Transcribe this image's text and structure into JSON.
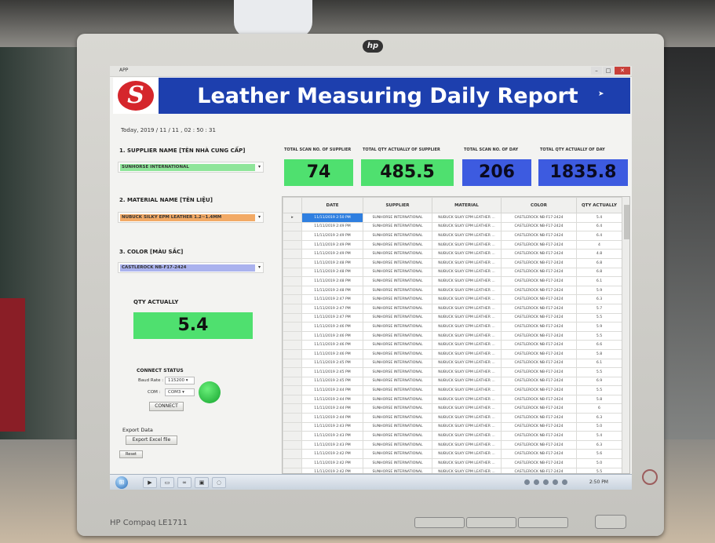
{
  "window": {
    "title": "APP",
    "controls": {
      "minimize": "–",
      "maximize": "□",
      "close": "✕"
    }
  },
  "banner": {
    "logo_letter": "S",
    "title": "Leather Measuring Daily Report"
  },
  "today": "Today, 2019 / 11 / 11 , 02 : 50 : 31",
  "supplier": {
    "label": "1. SUPPLIER NAME [TÊN NHÀ CUNG CẤP]",
    "value": "SUNHORSE INTERNATIONAL",
    "color": "#4fe06f"
  },
  "material": {
    "label": "2. MATERIAL NAME [TÊN LIỆU]",
    "value": "NUBUCK SILKY EPM LEATHER 1.2~1.4MM",
    "color": "#f0a05a"
  },
  "color_field": {
    "label": "3. COLOR [MÀU SẮC]",
    "value": "CASTLEROCK NB-F17-2424",
    "color": "#a5aef0"
  },
  "qty_actually": {
    "label": "QTY ACTUALLY",
    "value": "5.4"
  },
  "connect": {
    "title": "CONNECT STATUS",
    "baud_label": "Baud Rate :",
    "baud_value": "115200",
    "com_label": "COM :",
    "com_value": "COM3",
    "status_color": "#13a32d",
    "button": "CONNECT"
  },
  "export": {
    "label": "Export Data",
    "button": "Export Excel file",
    "reset": "Reset"
  },
  "kpis": [
    {
      "label": "TOTAL SCAN NO. OF SUPPLIER",
      "value": "74",
      "color": "green"
    },
    {
      "label": "TOTAL QTY ACTUALLY OF SUPPLIER",
      "value": "485.5",
      "color": "green"
    },
    {
      "label": "TOTAL SCAN NO. OF DAY",
      "value": "206",
      "color": "blue"
    },
    {
      "label": "TOTAL QTY ACTUALLY OF DAY",
      "value": "1835.8",
      "color": "blue"
    }
  ],
  "table": {
    "columns": [
      "DATE",
      "SUPPLIER",
      "MATERIAL",
      "COLOR",
      "QTY ACTUALLY"
    ],
    "rows": [
      [
        "11/11/2019 2:50 PM",
        "SUNHORSE INTERNATIONAL",
        "NUBUCK SILKY EPM LEATHER ...",
        "CASTLEROCK NB-F17-2424",
        "5.4"
      ],
      [
        "11/11/2019 2:49 PM",
        "SUNHORSE INTERNATIONAL",
        "NUBUCK SILKY EPM LEATHER ...",
        "CASTLEROCK NB-F17-2424",
        "6.4"
      ],
      [
        "11/11/2019 2:49 PM",
        "SUNHORSE INTERNATIONAL",
        "NUBUCK SILKY EPM LEATHER ...",
        "CASTLEROCK NB-F17-2424",
        "6.4"
      ],
      [
        "11/11/2019 2:49 PM",
        "SUNHORSE INTERNATIONAL",
        "NUBUCK SILKY EPM LEATHER ...",
        "CASTLEROCK NB-F17-2424",
        "4"
      ],
      [
        "11/11/2019 2:49 PM",
        "SUNHORSE INTERNATIONAL",
        "NUBUCK SILKY EPM LEATHER ...",
        "CASTLEROCK NB-F17-2424",
        "4.8"
      ],
      [
        "11/11/2019 2:48 PM",
        "SUNHORSE INTERNATIONAL",
        "NUBUCK SILKY EPM LEATHER ...",
        "CASTLEROCK NB-F17-2424",
        "6.8"
      ],
      [
        "11/11/2019 2:48 PM",
        "SUNHORSE INTERNATIONAL",
        "NUBUCK SILKY EPM LEATHER ...",
        "CASTLEROCK NB-F17-2424",
        "6.8"
      ],
      [
        "11/11/2019 2:48 PM",
        "SUNHORSE INTERNATIONAL",
        "NUBUCK SILKY EPM LEATHER ...",
        "CASTLEROCK NB-F17-2424",
        "6.1"
      ],
      [
        "11/11/2019 2:48 PM",
        "SUNHORSE INTERNATIONAL",
        "NUBUCK SILKY EPM LEATHER ...",
        "CASTLEROCK NB-F17-2424",
        "5.9"
      ],
      [
        "11/11/2019 2:47 PM",
        "SUNHORSE INTERNATIONAL",
        "NUBUCK SILKY EPM LEATHER ...",
        "CASTLEROCK NB-F17-2424",
        "6.3"
      ],
      [
        "11/11/2019 2:47 PM",
        "SUNHORSE INTERNATIONAL",
        "NUBUCK SILKY EPM LEATHER ...",
        "CASTLEROCK NB-F17-2424",
        "5.7"
      ],
      [
        "11/11/2019 2:47 PM",
        "SUNHORSE INTERNATIONAL",
        "NUBUCK SILKY EPM LEATHER ...",
        "CASTLEROCK NB-F17-2424",
        "5.5"
      ],
      [
        "11/11/2019 2:46 PM",
        "SUNHORSE INTERNATIONAL",
        "NUBUCK SILKY EPM LEATHER ...",
        "CASTLEROCK NB-F17-2424",
        "5.9"
      ],
      [
        "11/11/2019 2:46 PM",
        "SUNHORSE INTERNATIONAL",
        "NUBUCK SILKY EPM LEATHER ...",
        "CASTLEROCK NB-F17-2424",
        "5.5"
      ],
      [
        "11/11/2019 2:46 PM",
        "SUNHORSE INTERNATIONAL",
        "NUBUCK SILKY EPM LEATHER ...",
        "CASTLEROCK NB-F17-2424",
        "6.6"
      ],
      [
        "11/11/2019 2:46 PM",
        "SUNHORSE INTERNATIONAL",
        "NUBUCK SILKY EPM LEATHER ...",
        "CASTLEROCK NB-F17-2424",
        "5.8"
      ],
      [
        "11/11/2019 2:45 PM",
        "SUNHORSE INTERNATIONAL",
        "NUBUCK SILKY EPM LEATHER ...",
        "CASTLEROCK NB-F17-2424",
        "6.1"
      ],
      [
        "11/11/2019 2:45 PM",
        "SUNHORSE INTERNATIONAL",
        "NUBUCK SILKY EPM LEATHER ...",
        "CASTLEROCK NB-F17-2424",
        "5.5"
      ],
      [
        "11/11/2019 2:45 PM",
        "SUNHORSE INTERNATIONAL",
        "NUBUCK SILKY EPM LEATHER ...",
        "CASTLEROCK NB-F17-2424",
        "6.9"
      ],
      [
        "11/11/2019 2:44 PM",
        "SUNHORSE INTERNATIONAL",
        "NUBUCK SILKY EPM LEATHER ...",
        "CASTLEROCK NB-F17-2424",
        "5.5"
      ],
      [
        "11/11/2019 2:44 PM",
        "SUNHORSE INTERNATIONAL",
        "NUBUCK SILKY EPM LEATHER ...",
        "CASTLEROCK NB-F17-2424",
        "5.8"
      ],
      [
        "11/11/2019 2:44 PM",
        "SUNHORSE INTERNATIONAL",
        "NUBUCK SILKY EPM LEATHER ...",
        "CASTLEROCK NB-F17-2424",
        "6"
      ],
      [
        "11/11/2019 2:44 PM",
        "SUNHORSE INTERNATIONAL",
        "NUBUCK SILKY EPM LEATHER ...",
        "CASTLEROCK NB-F17-2424",
        "6.3"
      ],
      [
        "11/11/2019 2:43 PM",
        "SUNHORSE INTERNATIONAL",
        "NUBUCK SILKY EPM LEATHER ...",
        "CASTLEROCK NB-F17-2424",
        "5.0"
      ],
      [
        "11/11/2019 2:43 PM",
        "SUNHORSE INTERNATIONAL",
        "NUBUCK SILKY EPM LEATHER ...",
        "CASTLEROCK NB-F17-2424",
        "5.4"
      ],
      [
        "11/11/2019 2:43 PM",
        "SUNHORSE INTERNATIONAL",
        "NUBUCK SILKY EPM LEATHER ...",
        "CASTLEROCK NB-F17-2424",
        "6.3"
      ],
      [
        "11/11/2019 2:42 PM",
        "SUNHORSE INTERNATIONAL",
        "NUBUCK SILKY EPM LEATHER ...",
        "CASTLEROCK NB-F17-2424",
        "5.6"
      ],
      [
        "11/11/2019 2:42 PM",
        "SUNHORSE INTERNATIONAL",
        "NUBUCK SILKY EPM LEATHER ...",
        "CASTLEROCK NB-F17-2424",
        "5.0"
      ],
      [
        "11/11/2019 2:42 PM",
        "SUNHORSE INTERNATIONAL",
        "NUBUCK SILKY EPM LEATHER ...",
        "CASTLEROCK NB-F17-2424",
        "5.5"
      ]
    ],
    "selected_row_marker": "▸"
  },
  "taskbar": {
    "start": "⊞",
    "icons": [
      "media-player-icon",
      "folder-icon",
      "visual-studio-icon",
      "app-icon",
      "browser-icon"
    ],
    "clock": "2:50 PM"
  },
  "monitor": {
    "logo": "hp",
    "brand": "HP Compaq LE1711"
  }
}
